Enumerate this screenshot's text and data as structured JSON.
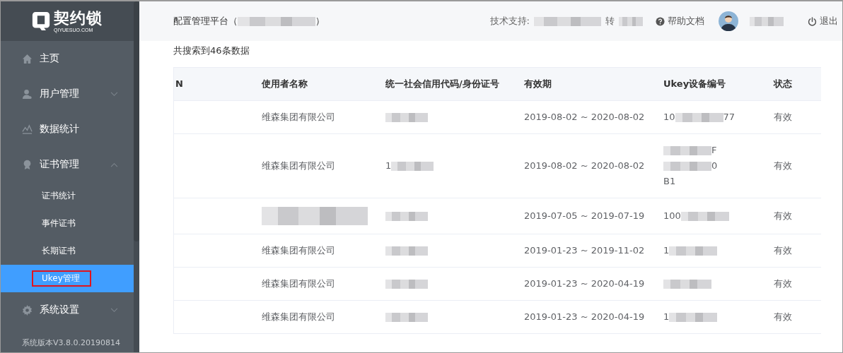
{
  "sidebar": {
    "logo": {
      "name": "契约锁",
      "domain": "QIYUESUO.COM"
    },
    "items": [
      {
        "label": "主页"
      },
      {
        "label": "用户管理",
        "expanded": false
      },
      {
        "label": "数据统计"
      },
      {
        "label": "证书管理",
        "expanded": true,
        "children": [
          {
            "label": "证书统计",
            "selected": false,
            "annotated": false
          },
          {
            "label": "事件证书",
            "selected": false,
            "annotated": false
          },
          {
            "label": "长期证书",
            "selected": false,
            "annotated": false
          },
          {
            "label": "Ukey管理",
            "selected": true,
            "annotated": true
          }
        ]
      },
      {
        "label": "系统设置",
        "expanded": false
      }
    ],
    "version": "系统版本V3.8.0.20190814"
  },
  "header": {
    "title_prefix": "配置管理平台（",
    "title_suffix": "）",
    "support_label": "技术支持:",
    "support_ext": "转",
    "help": "帮助文档",
    "logout": "退出"
  },
  "result_count": "共搜索到46条数据",
  "table": {
    "columns": [
      "N",
      "使用者名称",
      "统一社会信用代码/身份证号",
      "有效期",
      "Ukey设备编号",
      "状态"
    ],
    "rows": [
      {
        "name": [
          {
            "kind": "text",
            "text": "维森集团有限公司"
          }
        ],
        "code": [
          {
            "kind": "blurred"
          }
        ],
        "validity": "2019-08-02 ~ 2020-08-02",
        "ukey": [
          {
            "kind": "blurred",
            "prefix": "10",
            "suffix": "77"
          }
        ],
        "status": "有效"
      },
      {
        "name": [
          {
            "kind": "text",
            "text": "维森集团有限公司"
          }
        ],
        "code": [
          {
            "kind": "blurred",
            "prefix": "1"
          }
        ],
        "validity": "2019-08-02 ~ 2020-08-02",
        "ukey": [
          {
            "kind": "blurred",
            "suffix": "F"
          },
          {
            "kind": "blurred",
            "suffix": "0"
          },
          {
            "kind": "text",
            "text": "B1"
          }
        ],
        "status": "有效"
      },
      {
        "name": [
          {
            "kind": "blurred"
          },
          {
            "kind": "blurred"
          }
        ],
        "code": [
          {
            "kind": "blurred"
          }
        ],
        "validity": "2019-07-05 ~ 2019-07-19",
        "ukey": [
          {
            "kind": "blurred",
            "prefix": "100"
          }
        ],
        "status": "有效"
      },
      {
        "name": [
          {
            "kind": "text",
            "text": "维森集团有限公司"
          }
        ],
        "code": [
          {
            "kind": "blurred"
          }
        ],
        "validity": "2019-01-23 ~ 2019-11-02",
        "ukey": [
          {
            "kind": "blurred",
            "prefix": "1"
          }
        ],
        "status": "有效"
      },
      {
        "name": [
          {
            "kind": "text",
            "text": "维森集团有限公司"
          }
        ],
        "code": [
          {
            "kind": "blurred"
          }
        ],
        "validity": "2019-01-23 ~ 2020-04-19",
        "ukey": [
          {
            "kind": "blurred"
          }
        ],
        "status": "有效"
      },
      {
        "name": [
          {
            "kind": "text",
            "text": "维森集团有限公司"
          }
        ],
        "code": [
          {
            "kind": "blurred"
          }
        ],
        "validity": "2019-01-23 ~ 2020-04-19",
        "ukey": [
          {
            "kind": "blurred",
            "prefix": "1"
          }
        ],
        "status": "有效"
      }
    ]
  }
}
